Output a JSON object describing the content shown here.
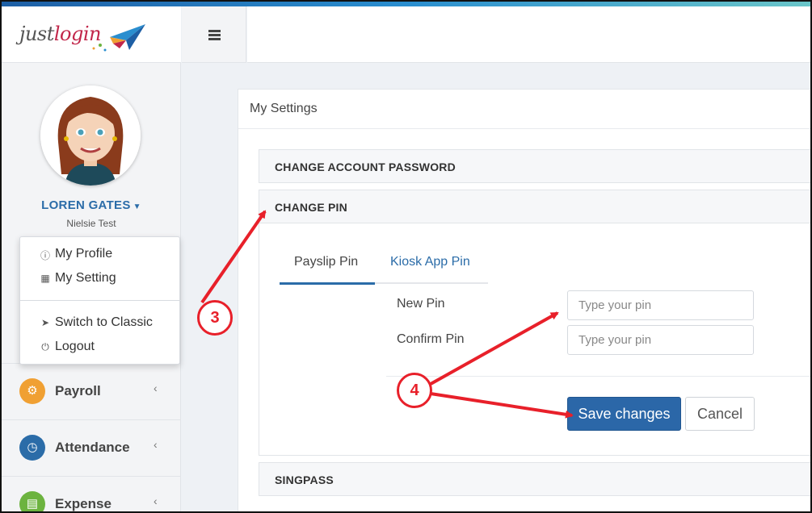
{
  "brand": {
    "logo_just": "just",
    "logo_login": "login"
  },
  "user": {
    "name": "LOREN GATES",
    "org": "Nielsie Test"
  },
  "user_menu": {
    "items": [
      {
        "label": "My Profile",
        "icon": "profile-icon"
      },
      {
        "label": "My Setting",
        "icon": "id-card-icon"
      },
      {
        "label": "Switch to Classic",
        "icon": "paper-plane-icon"
      },
      {
        "label": "Logout",
        "icon": "power-icon"
      }
    ]
  },
  "nav": {
    "items": [
      {
        "label": "Payroll",
        "icon": "payroll-icon",
        "color": "#f0a033"
      },
      {
        "label": "Attendance",
        "icon": "clock-icon",
        "color": "#2b6ca8"
      },
      {
        "label": "Expense",
        "icon": "receipt-icon",
        "color": "#6cb33f"
      }
    ]
  },
  "page": {
    "title": "My Settings",
    "sections": {
      "change_password": "CHANGE ACCOUNT PASSWORD",
      "change_pin": "CHANGE PIN",
      "singpass": "SINGPASS"
    }
  },
  "pin_tabs": [
    {
      "label": "Payslip Pin",
      "active": true
    },
    {
      "label": "Kiosk App Pin",
      "active": false
    }
  ],
  "pin_form": {
    "new_pin_label": "New Pin",
    "new_pin_placeholder": "Type your pin",
    "confirm_pin_label": "Confirm Pin",
    "confirm_pin_placeholder": "Type your pin",
    "save_label": "Save changes",
    "cancel_label": "Cancel"
  },
  "annotations": {
    "step3": "3",
    "step4": "4",
    "color": "#e8202a"
  },
  "colors": {
    "accent": "#2b67a8",
    "link": "#2b6ca8"
  }
}
